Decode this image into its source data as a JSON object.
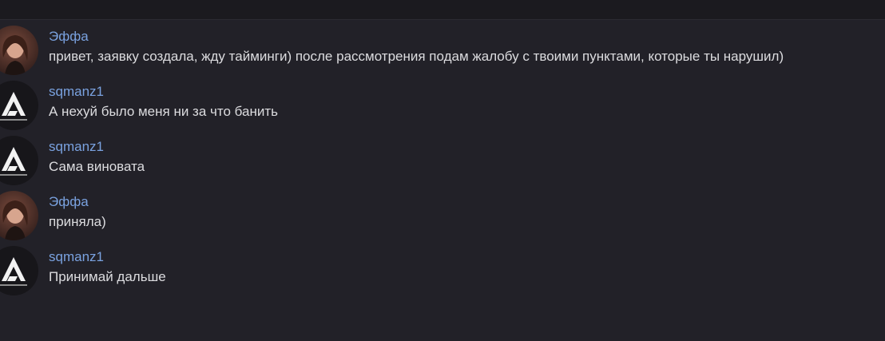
{
  "messages": [
    {
      "author": "Эффа",
      "text": "привет, заявку создала, жду тайминги) после рассмотрения подам жалобу с твоими пунктами, которые ты нарушил)",
      "avatar": "user-photo-avatar"
    },
    {
      "author": "sqmanz1",
      "text": "А нехуй было меня ни за что банить",
      "avatar": "logo-avatar"
    },
    {
      "author": "sqmanz1",
      "text": "Сама виновата",
      "avatar": "logo-avatar"
    },
    {
      "author": "Эффа",
      "text": "приняла)",
      "avatar": "user-photo-avatar"
    },
    {
      "author": "sqmanz1",
      "text": "Принимай дальше",
      "avatar": "logo-avatar"
    }
  ],
  "colors": {
    "background": "#222128",
    "topbar": "#1b1a1f",
    "author": "#7aa2e0",
    "text": "#dcdcdf"
  }
}
